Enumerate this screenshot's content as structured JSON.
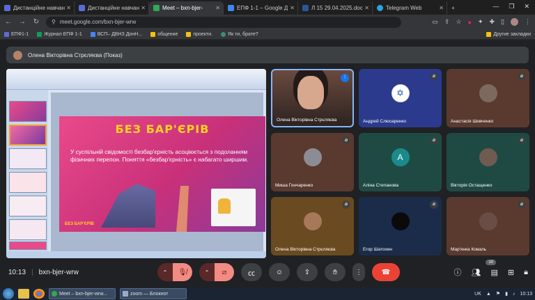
{
  "browser": {
    "tabs": [
      {
        "label": "Дистанційне навчан",
        "active": false,
        "color": "#5b6bd6"
      },
      {
        "label": "Дистанційне навчан",
        "active": false,
        "color": "#5b6bd6"
      },
      {
        "label": "Meet – bxn-bjer-",
        "active": true,
        "color": "#34a853"
      },
      {
        "label": "ЕПФ 1-1 – Google Д",
        "active": false,
        "color": "#4285f4"
      },
      {
        "label": "Л 15 29.04.2025.doc",
        "active": false,
        "color": "#2b579a"
      },
      {
        "label": "Telegram Web",
        "active": false,
        "color": "#2aa3e0"
      }
    ],
    "url": "meet.google.com/bxn-bjer-wrw",
    "bookmarks": [
      {
        "label": "ЕПФ1-1",
        "color": "#5b6bd6"
      },
      {
        "label": "Журнал ЕПФ 1-1",
        "color": "#0f9d58"
      },
      {
        "label": "ВСП– ДВНЗ ДонН...",
        "color": "#4285f4"
      },
      {
        "label": "общение",
        "color": "#f4c20d"
      },
      {
        "label": "проекти.",
        "color": "#f4c20d"
      },
      {
        "label": "Як ти, брате?",
        "color": "#3c8c7c"
      }
    ],
    "bookmarks_right": "Другие закладки"
  },
  "meet": {
    "presenter_label": "Олена Вікторівна Стрєляєва (Показ)",
    "slide": {
      "title": "БЕЗ БАР'ЄРІВ",
      "text": "У суспільній свідомості безбар'єрність асоціюється з подоланням фізичних перепон. Поняття «безбар'єрність» є набагато ширшим.",
      "logo": "БЕЗ БАР'ЄРІВ"
    },
    "participants": [
      {
        "name": "Олена Вікторівна Стрєляєва",
        "kind": "video",
        "bg": "#3a2a24",
        "muted": false
      },
      {
        "name": "Андрей Слюсаренко",
        "kind": "flag",
        "bg": "#2b3a8c",
        "muted": true
      },
      {
        "name": "Анастасія Шевченко",
        "kind": "photo",
        "bg": "#5a3a2e",
        "muted": true
      },
      {
        "name": "Миша Гончаренко",
        "kind": "photo",
        "bg": "#5a3a2e",
        "muted": true
      },
      {
        "name": "Аліна Степанова",
        "kind": "letter",
        "letter": "A",
        "bg": "#1f4a44",
        "muted": true
      },
      {
        "name": "Вікторія Остащенко",
        "kind": "photo",
        "bg": "#1f4a44",
        "muted": true
      },
      {
        "name": "Олена Вікторівна Стрєляєва",
        "kind": "photo",
        "bg": "#6a4a20",
        "muted": true
      },
      {
        "name": "Егор Шатохин",
        "kind": "black",
        "bg": "#1b2c4a",
        "muted": true
      },
      {
        "name": "Мар'янка Коваль",
        "kind": "photo",
        "bg": "#5a3a2e",
        "muted": true
      }
    ],
    "time": "10:13",
    "meeting_code": "bxn-bjer-wrw",
    "participant_count": "10"
  },
  "taskbar": {
    "tasks": [
      "Meet – bxn-bjer-wrw...",
      "zoom — Блокнот"
    ],
    "lang": "UK",
    "clock": "10:13"
  }
}
